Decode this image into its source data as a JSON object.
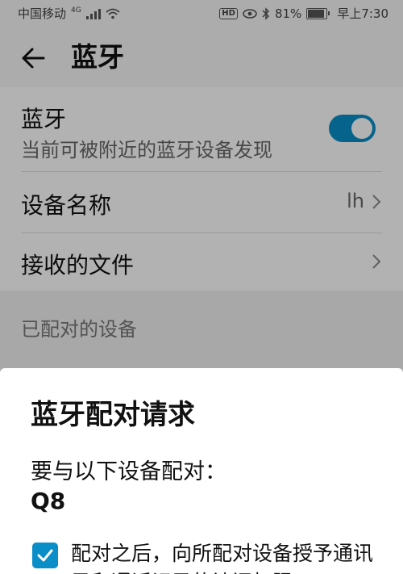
{
  "status_bar": {
    "carrier": "中国移动",
    "network": "4G",
    "hd": "HD",
    "battery": "81%",
    "time": "早上7:30"
  },
  "appbar": {
    "title": "蓝牙"
  },
  "settings": {
    "bluetooth": {
      "label": "蓝牙",
      "sub": "当前可被附近的蓝牙设备发现",
      "enabled": true
    },
    "device_name": {
      "label": "设备名称",
      "value": "lh"
    },
    "received_files": {
      "label": "接收的文件"
    },
    "paired_header": "已配对的设备"
  },
  "dialog": {
    "title": "蓝牙配对请求",
    "prompt": "要与以下设备配对：",
    "device": "Q8",
    "checkbox_label": "配对之后，向所配对设备授予通讯录和通话记录的访问权限"
  },
  "colors": {
    "accent": "#0a8ec8"
  }
}
